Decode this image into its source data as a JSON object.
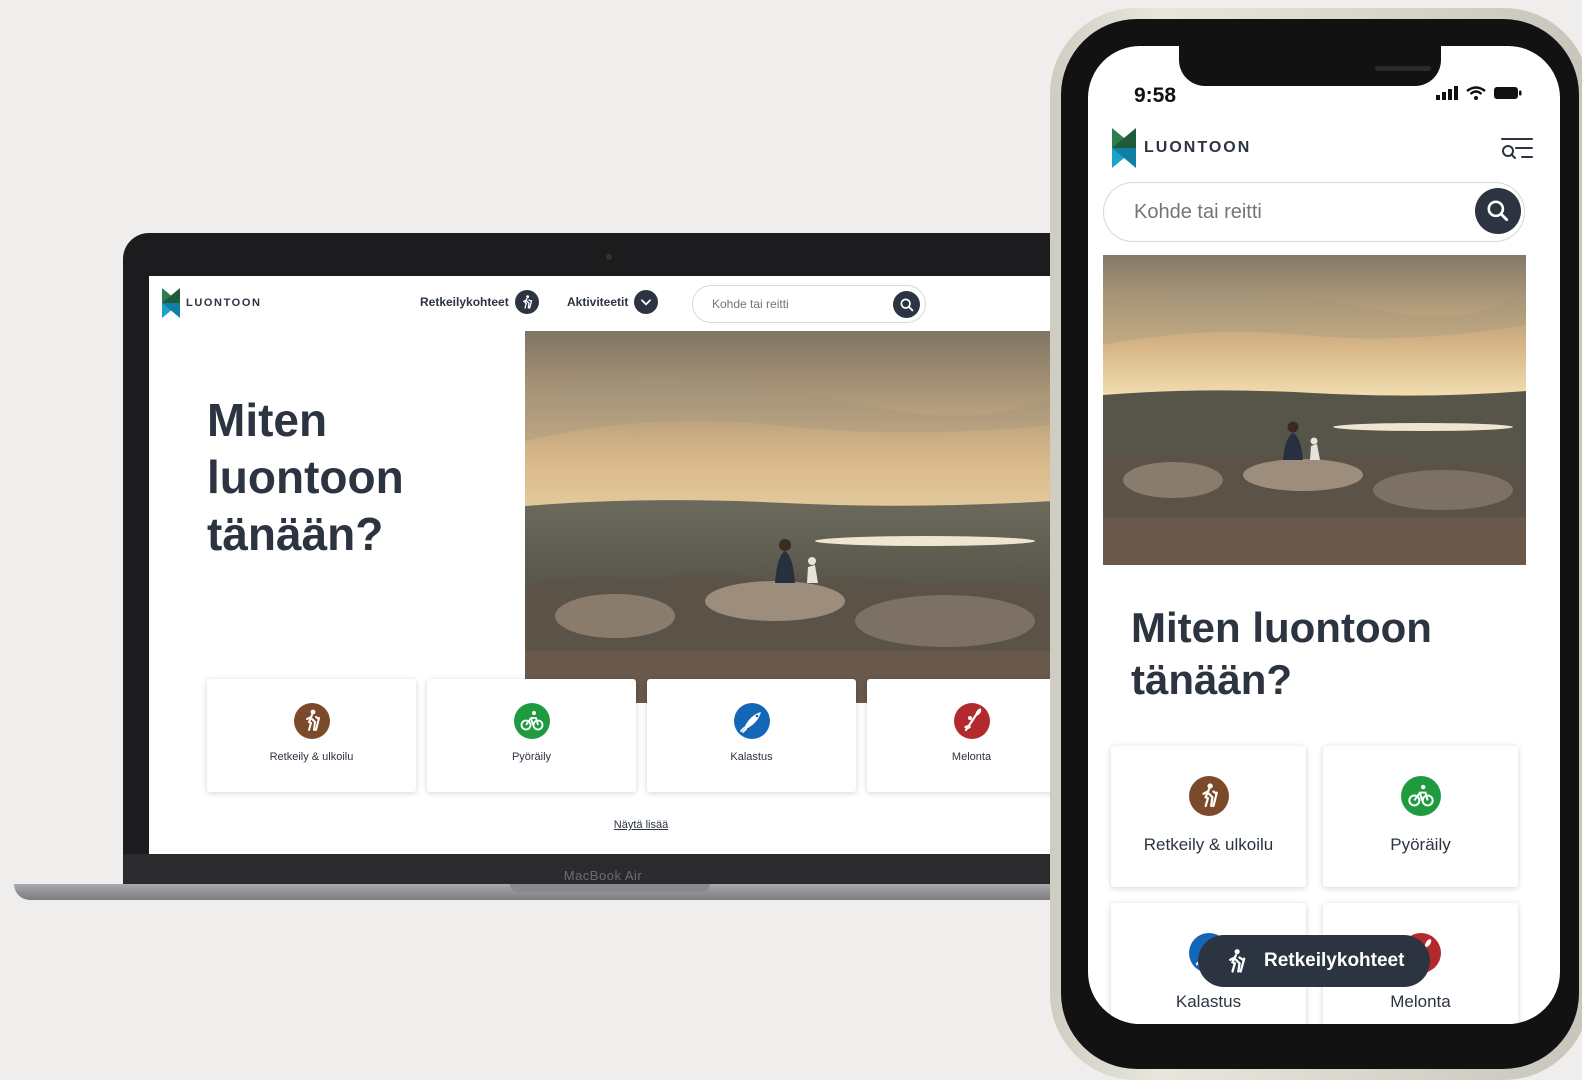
{
  "laptop": {
    "brand": "LUONTOON",
    "nav": {
      "destinations_label": "Retkeilykohteet",
      "activities_label": "Aktiviteetit"
    },
    "search": {
      "placeholder": "Kohde tai reitti"
    },
    "headline_lines": [
      "Miten",
      "luontoon",
      "tänään?"
    ],
    "activities": [
      {
        "label": "Retkeily & ulkoilu",
        "icon": "hiking-icon",
        "color": "#7b4a2a"
      },
      {
        "label": "Pyöräily",
        "icon": "bicycle-icon",
        "color": "#1f9a3f"
      },
      {
        "label": "Kalastus",
        "icon": "fishing-icon",
        "color": "#1466b8"
      },
      {
        "label": "Melonta",
        "icon": "paddle-icon",
        "color": "#b22a2e"
      }
    ],
    "show_more": "Näytä lisää",
    "device_label": "MacBook Air"
  },
  "phone": {
    "time": "9:58",
    "brand": "LUONTOON",
    "search": {
      "placeholder": "Kohde tai reitti"
    },
    "headline_lines": [
      "Miten luontoon",
      "tänään?"
    ],
    "activities": [
      {
        "label": "Retkeily & ulkoilu",
        "icon": "hiking-icon",
        "color": "#7b4a2a"
      },
      {
        "label": "Pyöräily",
        "icon": "bicycle-icon",
        "color": "#1f9a3f"
      },
      {
        "label": "Kalastus",
        "icon": "fishing-icon",
        "color": "#1466b8"
      },
      {
        "label": "Melonta",
        "icon": "paddle-icon",
        "color": "#b22a2e"
      }
    ],
    "fab_label": "Retkeilykohteet"
  },
  "colors": {
    "brand_dark": "#2b3440",
    "logo_green": "#2e7d4f",
    "logo_blue": "#1aa3c8",
    "background": "#efeeed"
  }
}
